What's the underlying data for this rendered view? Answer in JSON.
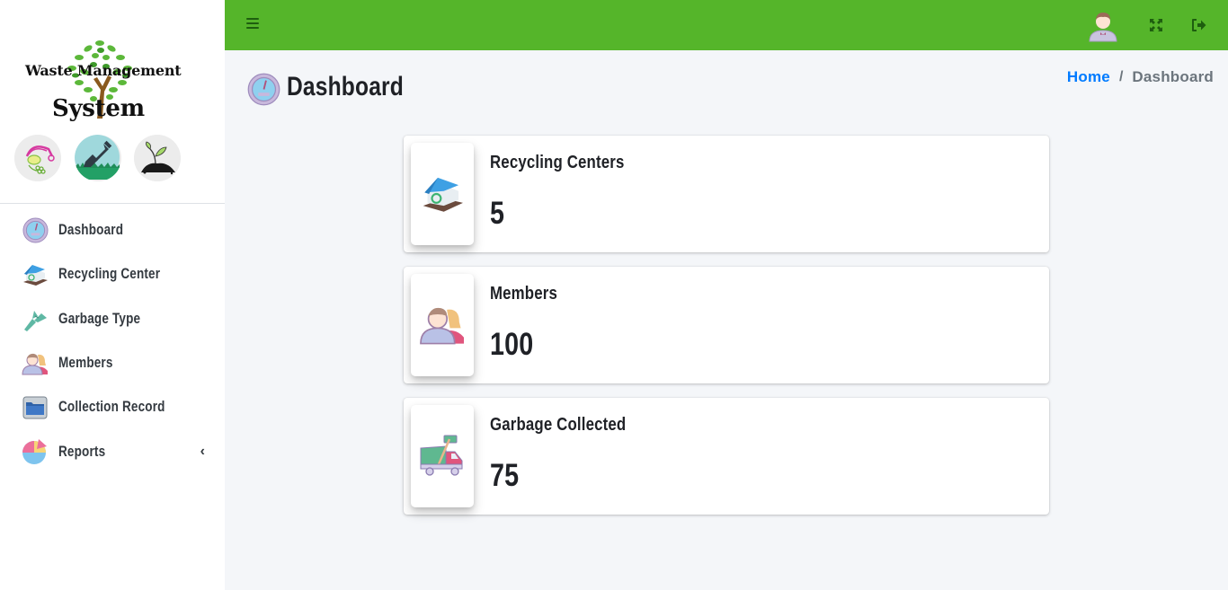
{
  "brand": {
    "line1": "Waste Management",
    "line2": "System",
    "logo_icon": "tree-logo-icon",
    "badges": [
      {
        "name": "recycle-leaf-icon"
      },
      {
        "name": "shovel-icon"
      },
      {
        "name": "sprout-soil-icon"
      }
    ]
  },
  "sidebar": {
    "items": [
      {
        "label": "Dashboard",
        "icon": "speedometer-icon"
      },
      {
        "label": "Recycling Center",
        "icon": "recycling-house-icon"
      },
      {
        "label": "Garbage Type",
        "icon": "garbage-type-icon"
      },
      {
        "label": "Members",
        "icon": "members-icon"
      },
      {
        "label": "Collection Record",
        "icon": "folder-icon"
      },
      {
        "label": "Reports",
        "icon": "pie-chart-icon",
        "has_submenu": true
      }
    ]
  },
  "topbar": {
    "menu_icon": "hamburger-icon",
    "user_icon": "user-avatar-icon",
    "expand_icon": "fullscreen-icon",
    "logout_icon": "logout-icon",
    "bg_color": "#55b52a"
  },
  "page": {
    "title": "Dashboard",
    "breadcrumb": {
      "home": "Home",
      "separator": "/",
      "current": "Dashboard"
    }
  },
  "stats": [
    {
      "label": "Recycling Centers",
      "value": "5",
      "icon": "recycling-house-icon"
    },
    {
      "label": "Members",
      "value": "100",
      "icon": "members-icon"
    },
    {
      "label": "Garbage Collected",
      "value": "75",
      "icon": "garbage-truck-icon"
    }
  ],
  "colors": {
    "accent_green": "#55b52a",
    "link_blue": "#007bff",
    "text_dark": "#1f2126",
    "muted": "#6c757d",
    "content_bg": "#f4f6f9"
  }
}
